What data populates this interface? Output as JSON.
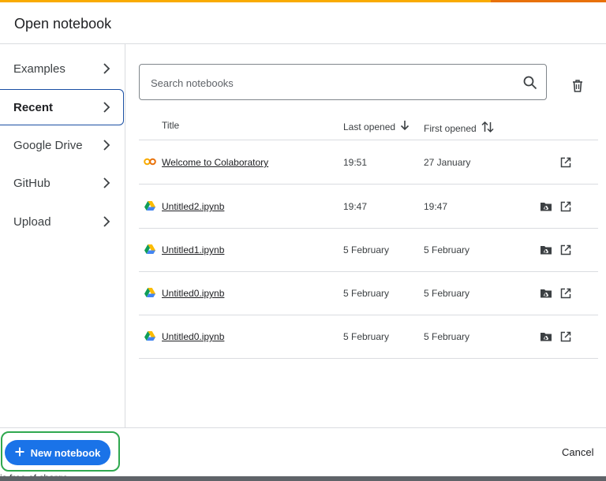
{
  "dialog": {
    "title": "Open notebook"
  },
  "sidebar": {
    "items": [
      {
        "label": "Examples"
      },
      {
        "label": "Recent"
      },
      {
        "label": "Google Drive"
      },
      {
        "label": "GitHub"
      },
      {
        "label": "Upload"
      }
    ],
    "active": "Recent"
  },
  "search": {
    "placeholder": "Search notebooks",
    "value": ""
  },
  "table": {
    "columns": {
      "title": "Title",
      "last_opened": "Last opened",
      "first_opened": "First opened"
    },
    "rows": [
      {
        "title": "Welcome to Colaboratory",
        "last_opened": "19:51",
        "first_opened": "27 January",
        "icon": "colab-icon",
        "has_drive_button": false
      },
      {
        "title": "Untitled2.ipynb",
        "last_opened": "19:47",
        "first_opened": "19:47",
        "icon": "google-drive-icon",
        "has_drive_button": true
      },
      {
        "title": "Untitled1.ipynb",
        "last_opened": "5 February",
        "first_opened": "5 February",
        "icon": "google-drive-icon",
        "has_drive_button": true
      },
      {
        "title": "Untitled0.ipynb",
        "last_opened": "5 February",
        "first_opened": "5 February",
        "icon": "google-drive-icon",
        "has_drive_button": true
      },
      {
        "title": "Untitled0.ipynb",
        "last_opened": "5 February",
        "first_opened": "5 February",
        "icon": "google-drive-icon",
        "has_drive_button": true
      }
    ]
  },
  "footer": {
    "new_notebook": "New notebook",
    "cancel": "Cancel"
  },
  "background": {
    "text": "is free of charge"
  },
  "colors": {
    "accent": "#1a73e8",
    "highlight": "#2fa84f",
    "top_bar": "#f9ab00"
  }
}
